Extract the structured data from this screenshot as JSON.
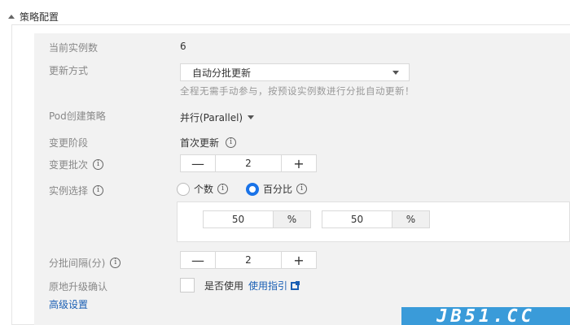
{
  "section": {
    "title": "策略配置"
  },
  "fields": {
    "current_instances": {
      "label": "当前实例数",
      "value": "6"
    },
    "update_mode": {
      "label": "更新方式",
      "selected": "自动分批更新",
      "hint": "全程无需手动参与，按预设实例数进行分批自动更新！"
    },
    "pod_strategy": {
      "label": "Pod创建策略",
      "selected": "并行(Parallel)"
    },
    "change_stage": {
      "label": "变更阶段",
      "value": "首次更新"
    },
    "change_batch": {
      "label": "变更批次",
      "value": "2",
      "minus": "—",
      "plus": "+"
    },
    "instance_select": {
      "label": "实例选择",
      "options": [
        {
          "label": "个数",
          "checked": false
        },
        {
          "label": "百分比",
          "checked": true
        }
      ],
      "percent_1": {
        "value": "50",
        "unit": "%"
      },
      "percent_2": {
        "value": "50",
        "unit": "%"
      }
    },
    "batch_interval": {
      "label": "分批间隔(分)",
      "value": "2",
      "minus": "—",
      "plus": "+"
    },
    "inplace_confirm": {
      "label": "原地升级确认",
      "checkbox_label": "是否使用",
      "guide_link": "使用指引"
    }
  },
  "advanced": {
    "label": "高级设置"
  },
  "watermark": {
    "text": "JB51.CC"
  },
  "icons": {
    "info": "info-icon",
    "external": "external-link-icon",
    "collapse": "caret-up-icon"
  }
}
